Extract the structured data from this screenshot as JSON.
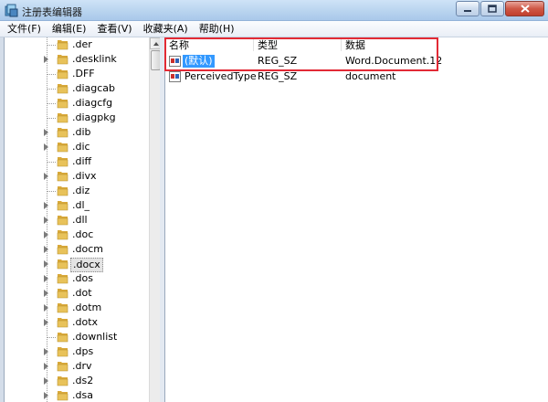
{
  "window": {
    "title": "注册表编辑器",
    "controls": [
      "minimize-icon",
      "maximize-icon",
      "close-icon"
    ]
  },
  "menu": {
    "items": [
      "文件(F)",
      "编辑(E)",
      "查看(V)",
      "收藏夹(A)",
      "帮助(H)"
    ]
  },
  "tree": {
    "items": [
      {
        "label": ".der",
        "expandable": false,
        "selected": false
      },
      {
        "label": ".desklink",
        "expandable": true,
        "selected": false
      },
      {
        "label": ".DFF",
        "expandable": false,
        "selected": false
      },
      {
        "label": ".diagcab",
        "expandable": false,
        "selected": false
      },
      {
        "label": ".diagcfg",
        "expandable": false,
        "selected": false
      },
      {
        "label": ".diagpkg",
        "expandable": false,
        "selected": false
      },
      {
        "label": ".dib",
        "expandable": true,
        "selected": false
      },
      {
        "label": ".dic",
        "expandable": true,
        "selected": false
      },
      {
        "label": ".diff",
        "expandable": false,
        "selected": false
      },
      {
        "label": ".divx",
        "expandable": true,
        "selected": false
      },
      {
        "label": ".diz",
        "expandable": false,
        "selected": false
      },
      {
        "label": ".dl_",
        "expandable": true,
        "selected": false
      },
      {
        "label": ".dll",
        "expandable": true,
        "selected": false
      },
      {
        "label": ".doc",
        "expandable": true,
        "selected": false
      },
      {
        "label": ".docm",
        "expandable": true,
        "selected": false
      },
      {
        "label": ".docx",
        "expandable": true,
        "selected": true
      },
      {
        "label": ".dos",
        "expandable": true,
        "selected": false
      },
      {
        "label": ".dot",
        "expandable": true,
        "selected": false
      },
      {
        "label": ".dotm",
        "expandable": true,
        "selected": false
      },
      {
        "label": ".dotx",
        "expandable": true,
        "selected": false
      },
      {
        "label": ".downlist",
        "expandable": false,
        "selected": false
      },
      {
        "label": ".dps",
        "expandable": true,
        "selected": false
      },
      {
        "label": ".drv",
        "expandable": true,
        "selected": false
      },
      {
        "label": ".ds2",
        "expandable": true,
        "selected": false
      },
      {
        "label": ".dsa",
        "expandable": true,
        "selected": false
      }
    ]
  },
  "list": {
    "columns": {
      "name": "名称",
      "type": "类型",
      "data": "数据"
    },
    "rows": [
      {
        "icon": "string-value-icon",
        "name": "(默认)",
        "type": "REG_SZ",
        "data": "Word.Document.12",
        "selected": true
      },
      {
        "icon": "string-value-icon",
        "name": "PerceivedType",
        "type": "REG_SZ",
        "data": "document",
        "selected": false
      }
    ]
  },
  "colors": {
    "selection": "#3399ff",
    "highlight_box": "#e22a35",
    "folder": "#e8c25a"
  }
}
